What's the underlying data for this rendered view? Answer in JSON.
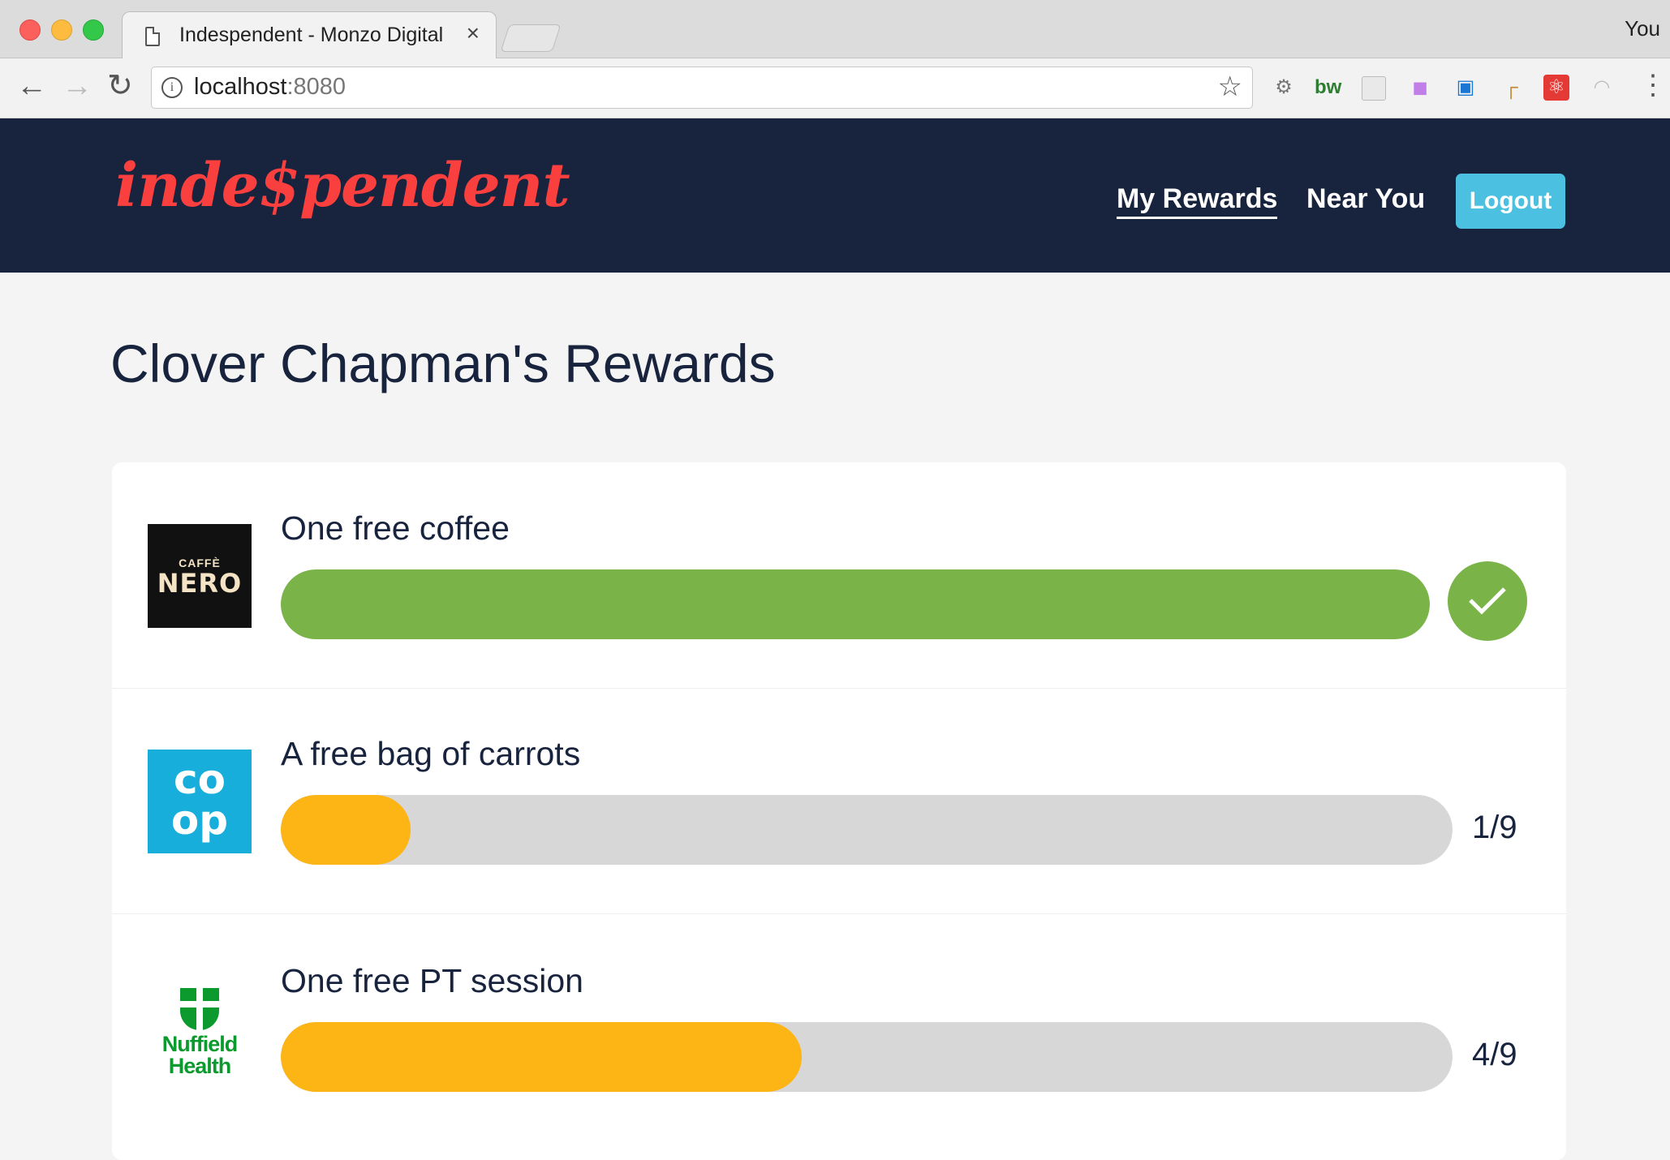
{
  "browser": {
    "tab_title": "Indespendent - Monzo Digital",
    "tab_close": "×",
    "profile": "You",
    "url_host": "localhost",
    "url_port": ":8080",
    "icons": [
      "back-icon",
      "forward-icon",
      "reload-icon",
      "info-icon",
      "star-icon",
      "menu-icon"
    ]
  },
  "header": {
    "logo_text": "inde$pendent",
    "nav_rewards": "My Rewards",
    "nav_near": "Near You",
    "logout": "Logout"
  },
  "page": {
    "title": "Clover Chapman's Rewards"
  },
  "rewards": [
    {
      "merchant": "Caffè Nero",
      "logo_small": "CAFFÈ",
      "logo_big": "NERO",
      "title": "One free coffee",
      "progress": 1.0,
      "complete": true,
      "count": "",
      "color": "#7ab449"
    },
    {
      "merchant": "Co-op",
      "logo_line1": "co",
      "logo_line2": "op",
      "title": "A free bag of carrots",
      "progress": 0.1111,
      "complete": false,
      "count": "1/9",
      "color": "#fdb415"
    },
    {
      "merchant": "Nuffield Health",
      "logo_line1": "Nuffield",
      "logo_line2": "Health",
      "title": "One free PT session",
      "progress": 0.4444,
      "complete": false,
      "count": "4/9",
      "color": "#fdb415"
    }
  ],
  "colors": {
    "header_bg": "#18233e",
    "logo": "#fa3f3f",
    "logout_bg": "#4cc0e0",
    "complete": "#7ab449",
    "in_progress": "#fdb415",
    "track": "#d7d7d7"
  }
}
